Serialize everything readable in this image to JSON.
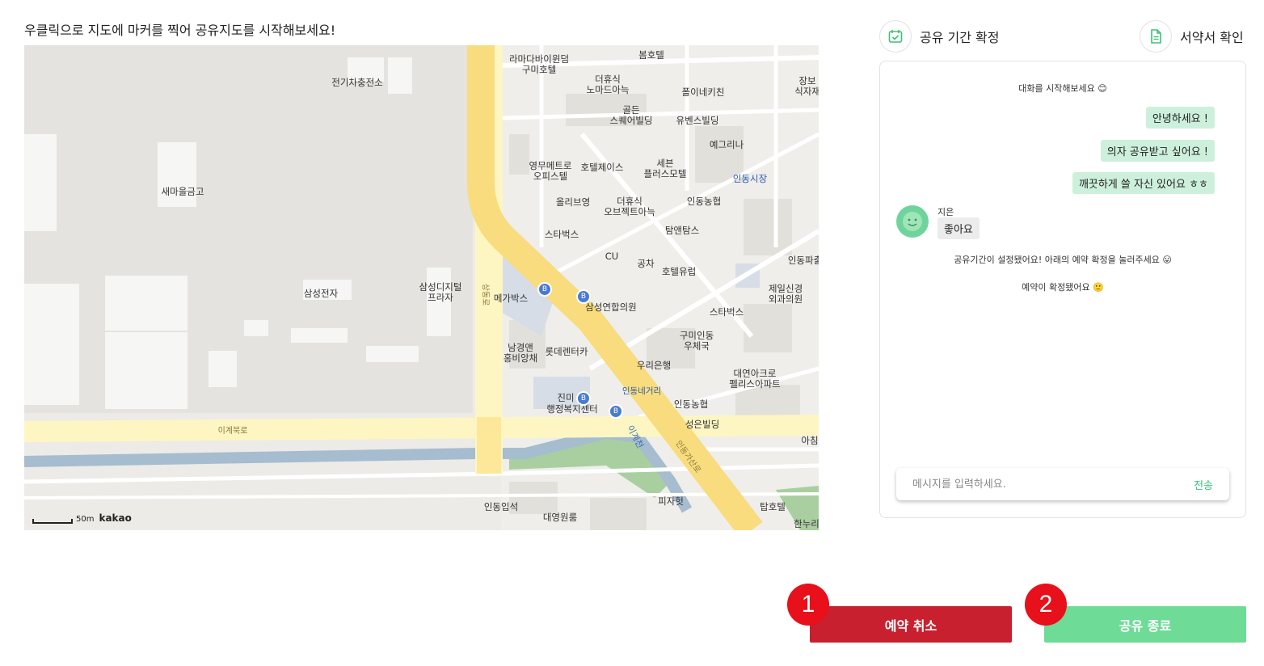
{
  "instruction": "우클릭으로 지도에 마커를 찍어 공유지도를 시작해보세요!",
  "top_actions": {
    "confirm_period": "공유 기간 확정",
    "confirm_contract": "서약서 확인"
  },
  "map": {
    "labels": {
      "charging": "전기차충전소",
      "samaeul": "새마을금고",
      "samsung": "삼성전자",
      "samsung_digital": "삼성디지털\n프라자",
      "lamada": "라마다바이윈덤\n구미호텔",
      "bomhotel": "봄호텔",
      "deohyusik_noma": "더휴식\n노마드아늑",
      "polyne": "폴이네키친",
      "golden": "골든\n스퀘어빌딩",
      "yuben": "유벤스빌딩",
      "yegrina": "예그리나",
      "jangbo": "장보\n식자재",
      "youngmu": "영무메트로\n오피스텔",
      "hotelj": "호텔제이스",
      "seven": "세븐\n플러스모텔",
      "indong_market": "인동시장",
      "olive": "올리브영",
      "deohyusik_obj": "더휴식\n오브젝트아늑",
      "indong_nh1": "인동농협",
      "starbucks1": "스타벅스",
      "tamtams": "탐앤탐스",
      "cu": "CU",
      "gongcha": "공차",
      "hotel_yurep": "호텔유럽",
      "indong_pa": "인동파출",
      "megabox": "메가박스",
      "samsung_clinic": "삼성연합의원",
      "jeil": "제일신경\n외과의원",
      "starbucks2": "스타벅스",
      "gumi_post": "구미인동\n우체국",
      "namgyeong": "남경앤\n홍비앙채",
      "lotte_rent": "롯데렌터카",
      "woori": "우리은행",
      "daeyeon": "대연아크로\n펠리스아파트",
      "jinmi": "진미",
      "admin_center": "행정복지센터",
      "indong_cross": "인동네거리",
      "indong_nh2": "인동농협",
      "seongeun": "성은빌딩",
      "achim": "아침",
      "igye_road": "이계북로",
      "igyecheon": "이계천",
      "indong_road": "인동가산로",
      "sangdong_road": "상동로",
      "indong_ipseok": "인동입석",
      "daeyeong": "대영원룸",
      "pizza": "피자헛",
      "top_hotel": "탑호텔",
      "hannuri": "한누리"
    },
    "scale_text": "50m",
    "brand": "kakao"
  },
  "chat": {
    "system_start": "대화를 시작해보세요 😊",
    "my_messages": [
      "안녕하세요 !",
      "의자 공유받고 싶어요 !",
      "깨끗하게 쓸 자신 있어요 ㅎㅎ"
    ],
    "other_name": "지은",
    "other_message": "좋아요",
    "system_period": "공유기간이 설정됐어요! 아래의 예약 확정을 눌러주세요 😛",
    "system_confirmed": "예약이 확정됐어요 🙂",
    "input_placeholder": "메시지를 입력하세요.",
    "send_label": "전송"
  },
  "actions": {
    "cancel_label": "예약 취소",
    "end_label": "공유 종료",
    "badge1": "1",
    "badge2": "2"
  },
  "colors": {
    "cancel": "#c8202f",
    "end": "#6edb96",
    "accent_green": "#3ec07a",
    "bubble_me": "#cdf0dc",
    "badge": "#e8101a"
  }
}
